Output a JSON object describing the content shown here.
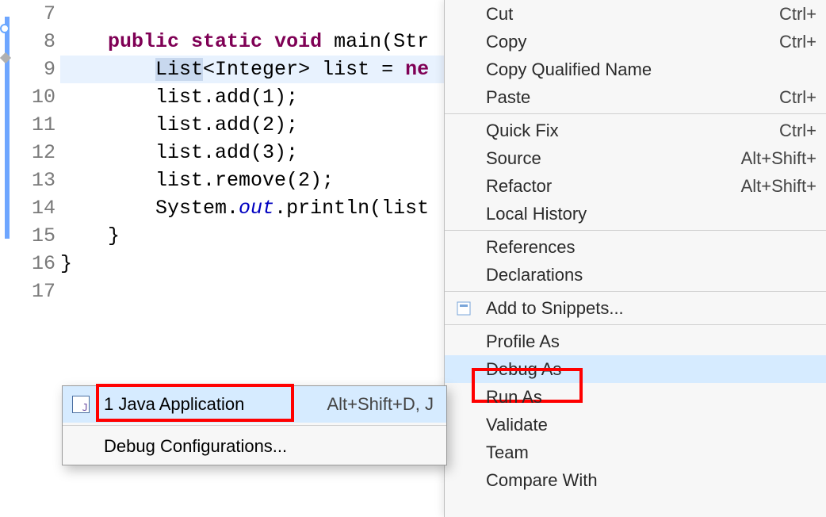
{
  "editor": {
    "lines": [
      {
        "n": "7",
        "html": ""
      },
      {
        "n": "8",
        "html": "    <span class='kw'>public</span> <span class='kw'>static</span> <span class='kw'>void</span> main(Str"
      },
      {
        "n": "9",
        "html": "        <span class='sel'>List</span>&lt;Integer&gt; list = <span class='kw'>ne</span>",
        "hl": true
      },
      {
        "n": "10",
        "html": "        list.add(1);"
      },
      {
        "n": "11",
        "html": "        list.add(2);"
      },
      {
        "n": "12",
        "html": "        list.add(3);"
      },
      {
        "n": "13",
        "html": "        list.remove(2);"
      },
      {
        "n": "14",
        "html": "        System.<span class='fld'>out</span>.println(list"
      },
      {
        "n": "15",
        "html": "    }"
      },
      {
        "n": "16",
        "html": "}"
      },
      {
        "n": "17",
        "html": ""
      }
    ]
  },
  "context_menu": {
    "items": [
      {
        "label": "Cut",
        "shortcut": "Ctrl+"
      },
      {
        "label": "Copy",
        "shortcut": "Ctrl+"
      },
      {
        "label": "Copy Qualified Name"
      },
      {
        "label": "Paste",
        "shortcut": "Ctrl+"
      },
      {
        "sep": true
      },
      {
        "label": "Quick Fix",
        "shortcut": "Ctrl+"
      },
      {
        "label": "Source",
        "shortcut": "Alt+Shift+"
      },
      {
        "label": "Refactor",
        "shortcut": "Alt+Shift+"
      },
      {
        "label": "Local History"
      },
      {
        "sep": true
      },
      {
        "label": "References"
      },
      {
        "label": "Declarations"
      },
      {
        "sep": true
      },
      {
        "label": "Add to Snippets...",
        "icon": "snippet"
      },
      {
        "sep": true
      },
      {
        "label": "Profile As"
      },
      {
        "label": "Debug As",
        "highlight": true,
        "redbox": true
      },
      {
        "label": "Run As"
      },
      {
        "label": "Validate"
      },
      {
        "label": "Team"
      },
      {
        "label": "Compare With"
      }
    ]
  },
  "submenu": {
    "items": [
      {
        "label": "1 Java Application",
        "shortcut": "Alt+Shift+D, J",
        "highlight": true,
        "icon": true,
        "redbox": true
      },
      {
        "sep": true
      },
      {
        "label": "Debug Configurations..."
      }
    ]
  }
}
